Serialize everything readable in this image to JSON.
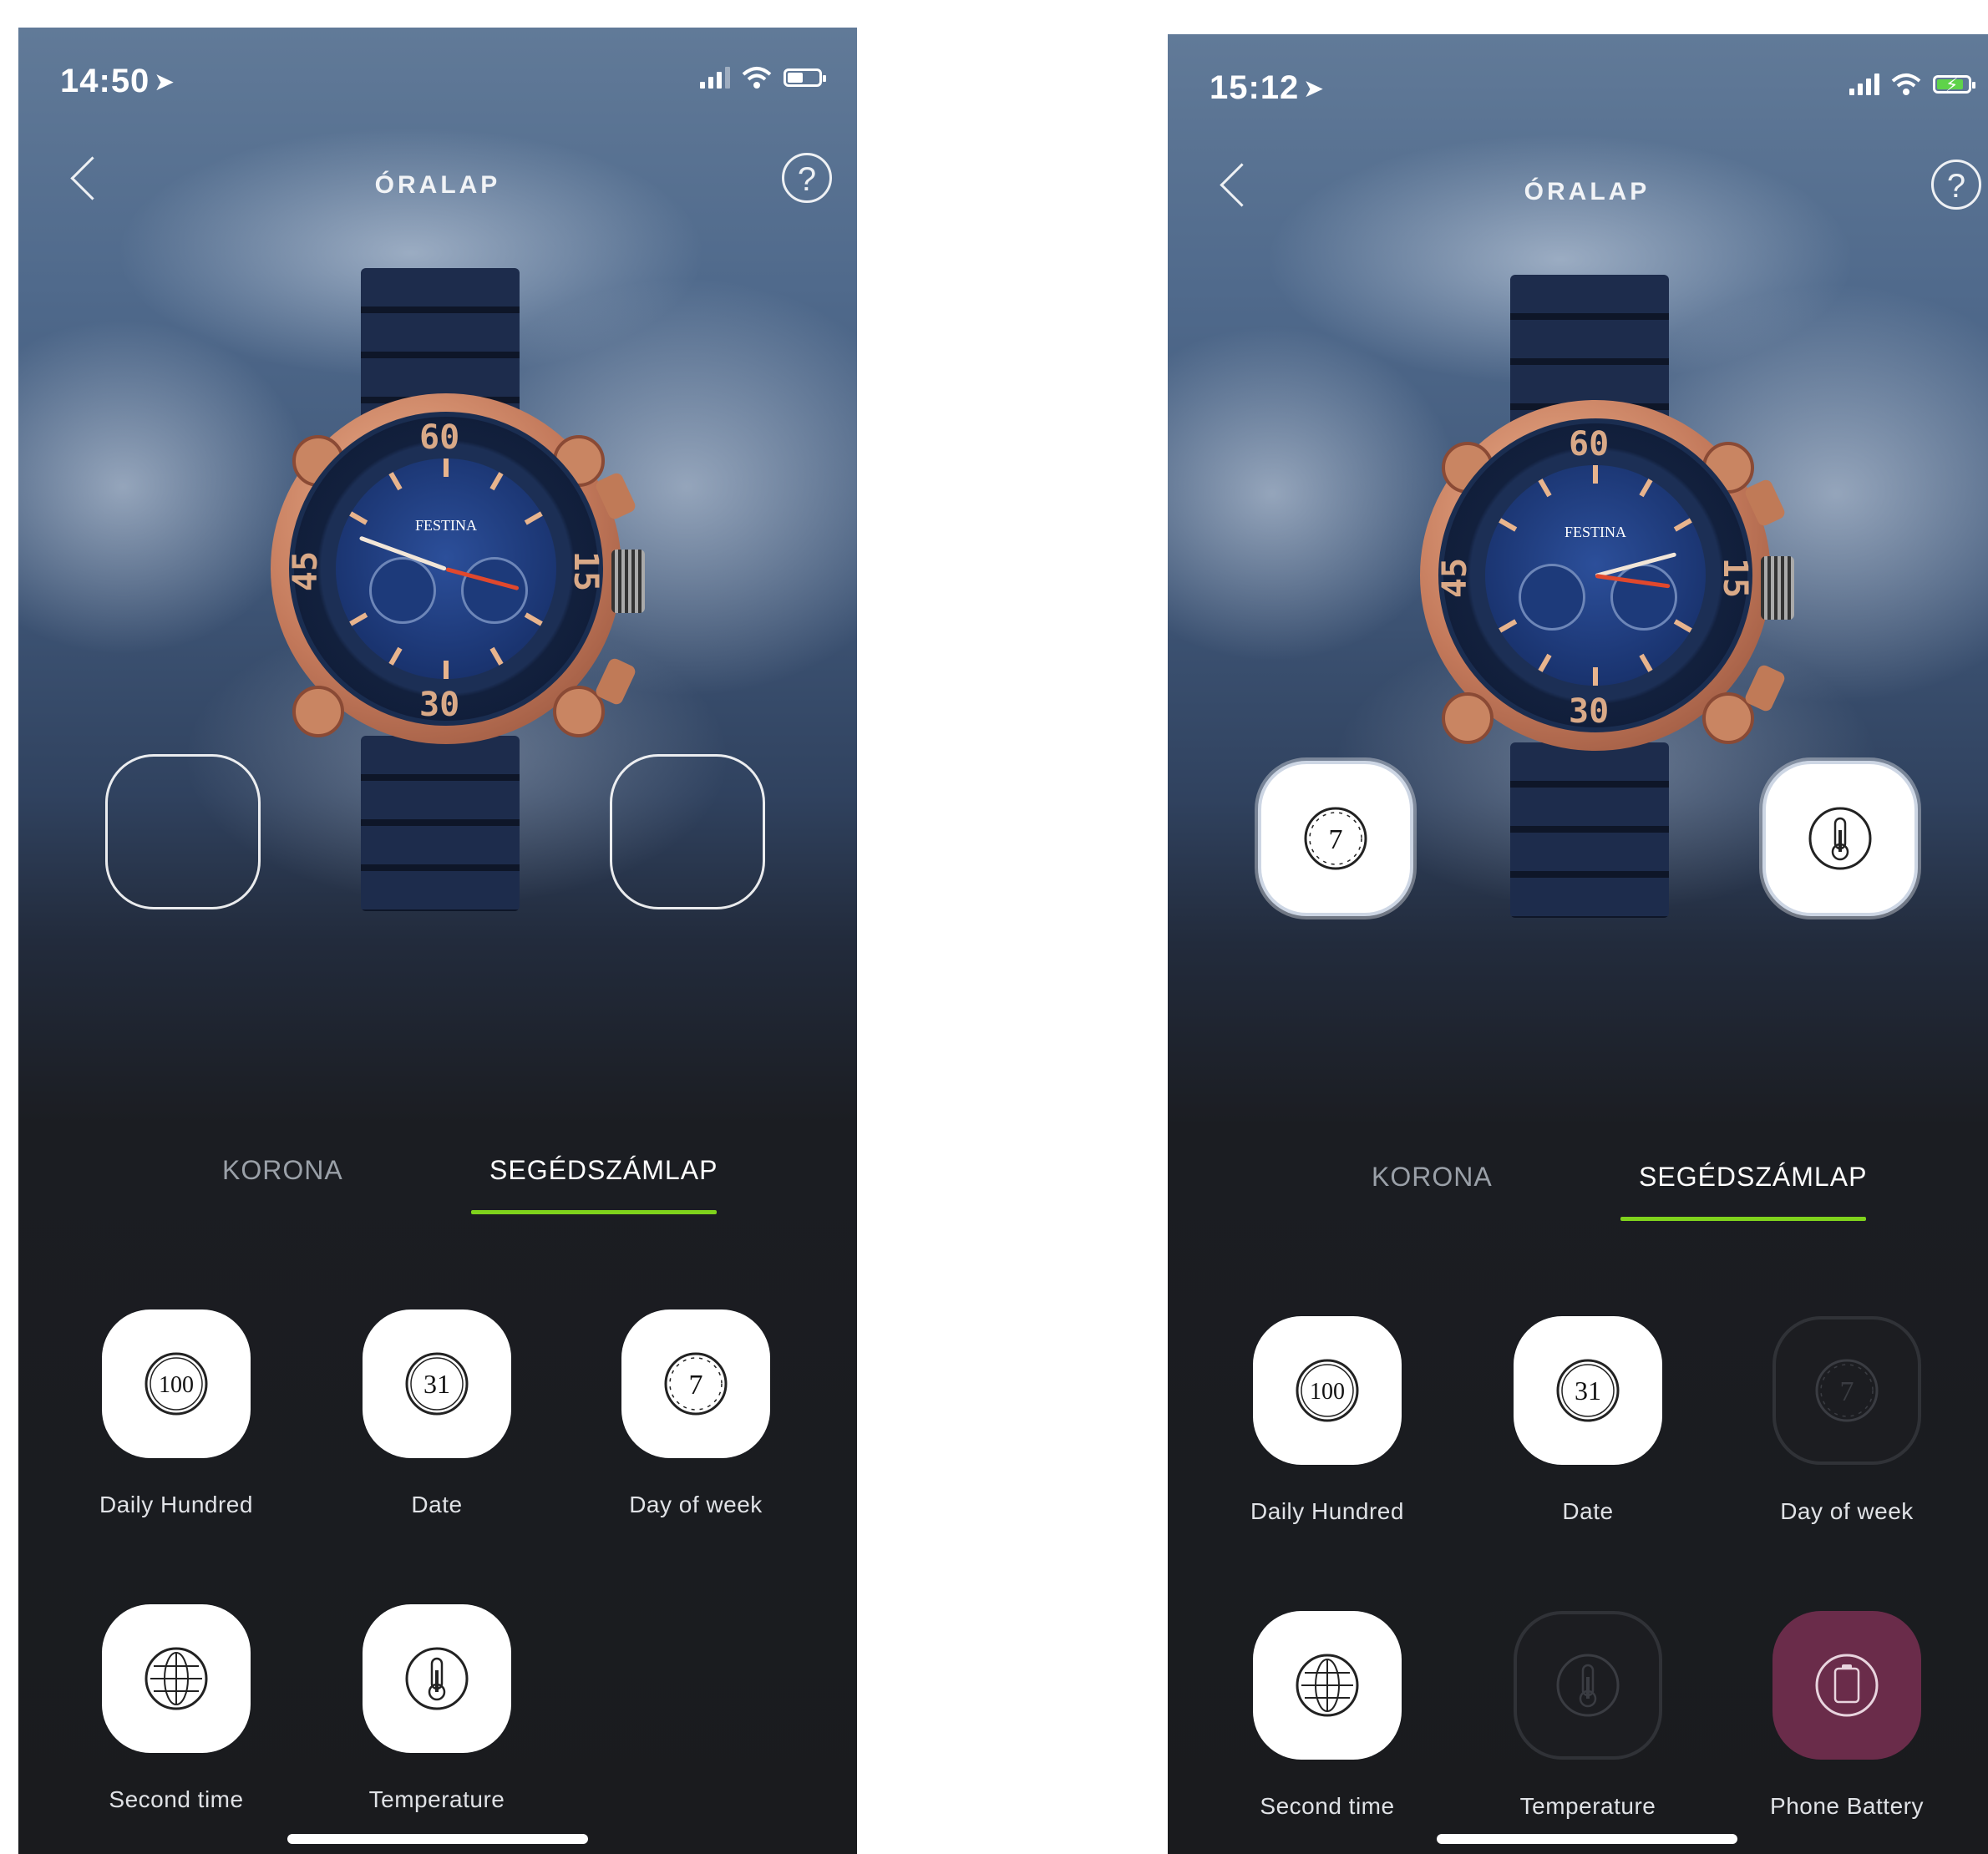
{
  "screens": [
    {
      "status": {
        "time": "14:50",
        "location_icon": "location-arrow-icon",
        "charging": false
      },
      "nav": {
        "title": "ÓRALAP"
      },
      "watch": {
        "brand": "FESTINA",
        "bezel": [
          "60",
          "15",
          "30",
          "45"
        ]
      },
      "slots": {
        "left": "empty",
        "right": "empty"
      },
      "tabs": [
        {
          "label": "KORONA",
          "active": false
        },
        {
          "label": "SEGÉDSZÁMLAP",
          "active": true
        }
      ],
      "complications": [
        {
          "label": "Daily Hundred",
          "glyph": "100",
          "icon": "daily-hundred-icon",
          "state": "normal"
        },
        {
          "label": "Date",
          "glyph": "31",
          "icon": "date-icon",
          "state": "normal"
        },
        {
          "label": "Day of week",
          "glyph": "7",
          "icon": "day-of-week-icon",
          "state": "normal"
        },
        {
          "label": "Second time",
          "glyph": "",
          "icon": "globe-icon",
          "state": "normal"
        },
        {
          "label": "Temperature",
          "glyph": "",
          "icon": "thermometer-icon",
          "state": "normal"
        }
      ]
    },
    {
      "status": {
        "time": "15:12",
        "location_icon": "location-arrow-icon",
        "charging": true
      },
      "nav": {
        "title": "ÓRALAP"
      },
      "watch": {
        "brand": "FESTINA",
        "bezel": [
          "60",
          "15",
          "30",
          "45"
        ]
      },
      "slots": {
        "left": "day-of-week-icon",
        "right": "thermometer-icon"
      },
      "tabs": [
        {
          "label": "KORONA",
          "active": false
        },
        {
          "label": "SEGÉDSZÁMLAP",
          "active": true
        }
      ],
      "complications": [
        {
          "label": "Daily Hundred",
          "glyph": "100",
          "icon": "daily-hundred-icon",
          "state": "normal"
        },
        {
          "label": "Date",
          "glyph": "31",
          "icon": "date-icon",
          "state": "normal"
        },
        {
          "label": "Day of week",
          "glyph": "7",
          "icon": "day-of-week-icon",
          "state": "disabled"
        },
        {
          "label": "Second time",
          "glyph": "",
          "icon": "globe-icon",
          "state": "normal"
        },
        {
          "label": "Temperature",
          "glyph": "",
          "icon": "thermometer-icon",
          "state": "disabled"
        },
        {
          "label": "Phone Battery",
          "glyph": "",
          "icon": "phone-battery-icon",
          "state": "selected"
        }
      ]
    }
  ],
  "colors": {
    "accent": "#7fd21c",
    "selected_tile": "#6a2c4a",
    "background": "#1a1b1e"
  }
}
